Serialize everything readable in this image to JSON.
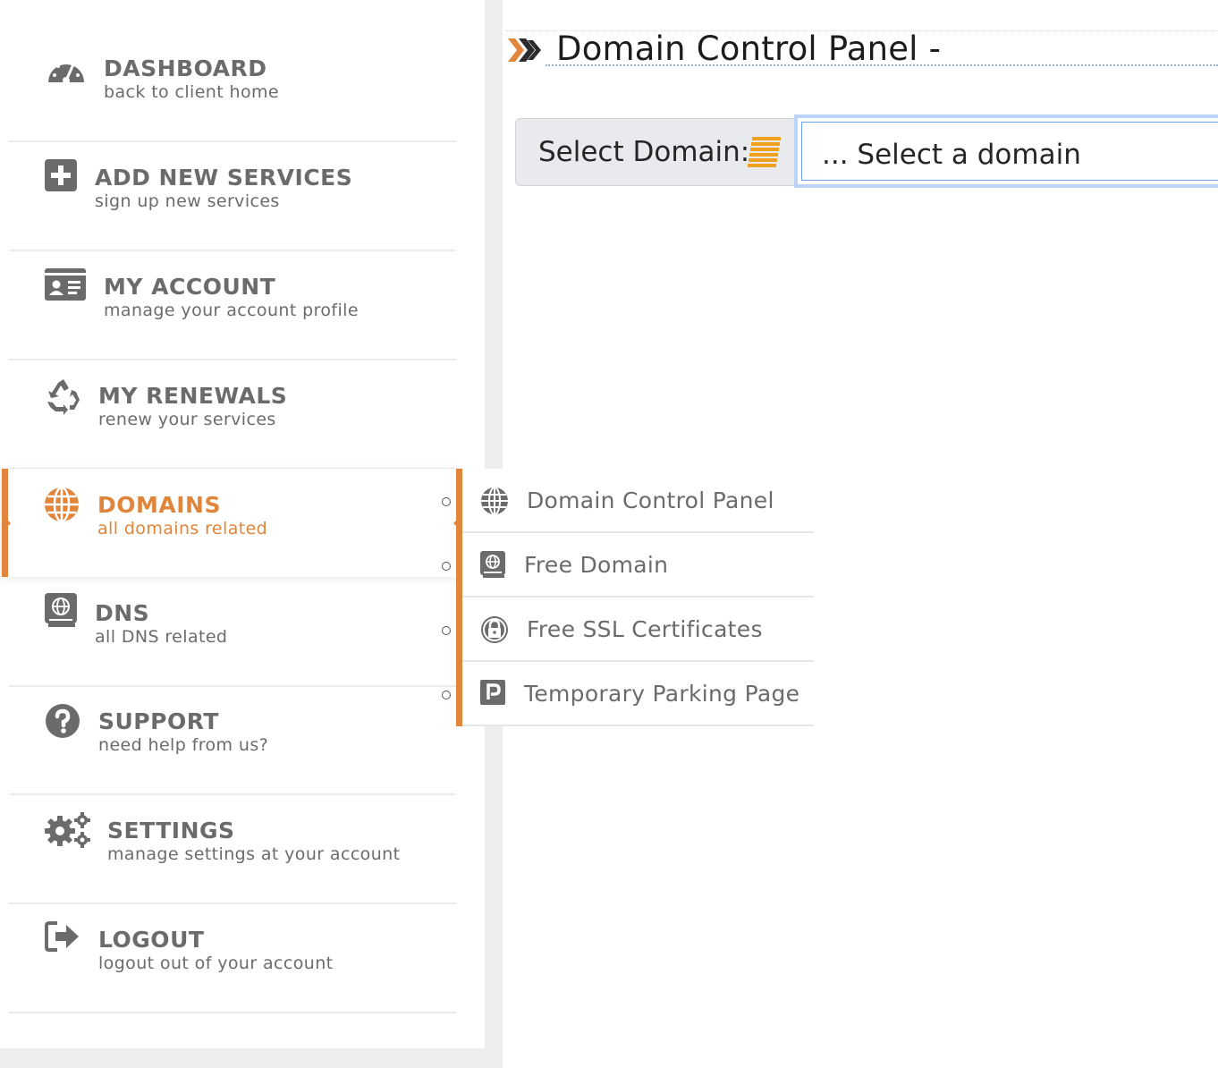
{
  "sidebar": {
    "items": [
      {
        "title": "DASHBOARD",
        "sub": "back to client home",
        "icon": "dashboard-gauge-icon"
      },
      {
        "title": "ADD NEW SERVICES",
        "sub": "sign up new services",
        "icon": "plus-square-icon"
      },
      {
        "title": "MY ACCOUNT",
        "sub": "manage your account profile",
        "icon": "id-card-icon"
      },
      {
        "title": "MY RENEWALS",
        "sub": "renew your services",
        "icon": "recycle-icon"
      },
      {
        "title": "DOMAINS",
        "sub": "all domains related",
        "icon": "globe-icon",
        "active": true
      },
      {
        "title": "DNS",
        "sub": "all DNS related",
        "icon": "dns-book-icon"
      },
      {
        "title": "SUPPORT",
        "sub": "need help from us?",
        "icon": "question-circle-icon"
      },
      {
        "title": "SETTINGS",
        "sub": "manage settings at your account",
        "icon": "gears-icon"
      },
      {
        "title": "LOGOUT",
        "sub": "logout out of your account",
        "icon": "sign-out-icon"
      }
    ]
  },
  "submenu": {
    "items": [
      {
        "label": "Domain Control Panel",
        "icon": "globe-icon"
      },
      {
        "label": "Free Domain",
        "icon": "globe-book-icon"
      },
      {
        "label": "Free SSL Certificates",
        "icon": "lock-circle-icon"
      },
      {
        "label": "Temporary Parking Page",
        "icon": "parking-icon"
      }
    ]
  },
  "main": {
    "page_title": "Domain Control Panel -",
    "select_label": "Select Domain:",
    "select_value": "... Select a domain"
  },
  "colors": {
    "accent": "#e0853a",
    "text_gray": "#6b6b6b",
    "focus_blue": "#6ca0ee"
  }
}
